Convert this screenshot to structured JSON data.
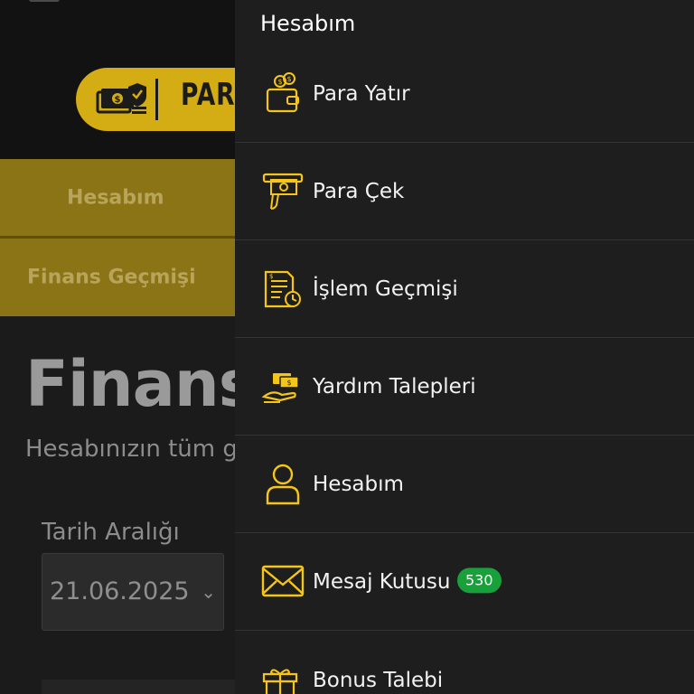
{
  "background": {
    "brand_text": "PARA",
    "tabs": [
      {
        "label": "Hesabım"
      },
      {
        "label": "Finans Geçmişi"
      }
    ],
    "page_title": "Finans",
    "page_subtitle": "Hesabınızın tüm g",
    "date_range_label": "Tarih Aralığı",
    "date_value": "21.06.2025"
  },
  "drawer": {
    "header": "Hesabım",
    "items": [
      {
        "label": "Para Yatır",
        "icon": "deposit-wallet-icon"
      },
      {
        "label": "Para Çek",
        "icon": "withdraw-cash-icon"
      },
      {
        "label": "İşlem Geçmişi",
        "icon": "transaction-history-icon"
      },
      {
        "label": "Yardım Talepleri",
        "icon": "support-ticket-icon"
      },
      {
        "label": "Hesabım",
        "icon": "user-icon"
      },
      {
        "label": "Mesaj Kutusu",
        "icon": "envelope-icon",
        "badge": "530"
      },
      {
        "label": "Bonus Talebi",
        "icon": "gift-icon"
      }
    ]
  },
  "colors": {
    "accent": "#f5c518",
    "tab_bg": "#8a7416",
    "drawer_bg": "#1e1e1e",
    "badge": "#18a13b"
  }
}
